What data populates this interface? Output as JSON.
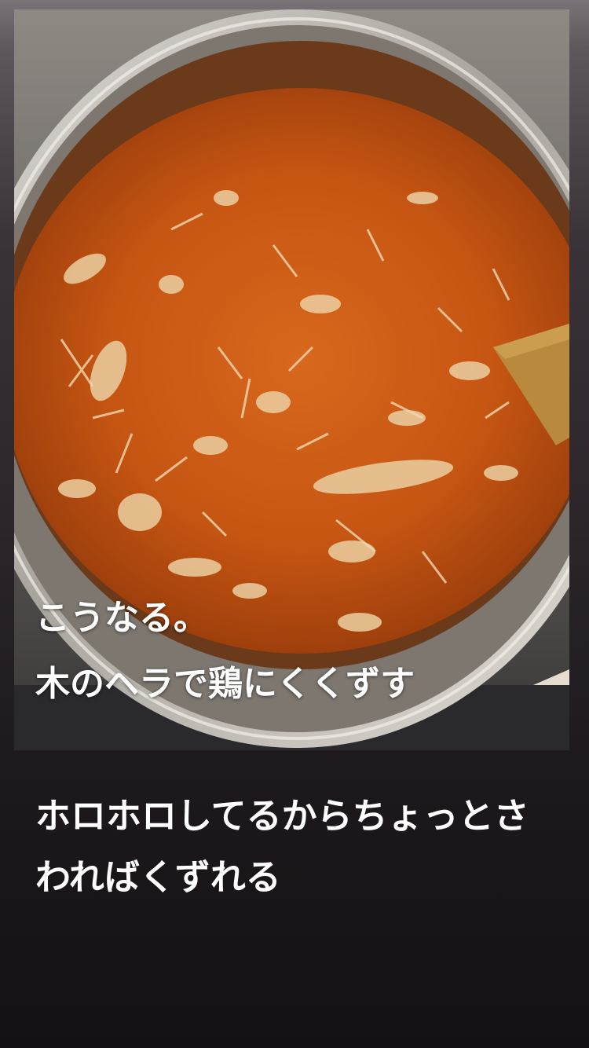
{
  "photo": {
    "alt": "",
    "colors": {
      "pot_rim": "#c9c5c0",
      "pot_inner": "#8a847d",
      "sauce": "#c85a14",
      "sauce_dark": "#9a3e0a",
      "chicken": "#e8c79a",
      "spatula": "#b98a3e",
      "stove": "#2b2a2c",
      "counter": "#e9e1d6"
    },
    "caption_line1": "こうなる。",
    "caption_line2": "木のヘラで鶏にくくずす"
  },
  "story": {
    "text": "ホロホロしてるからちょっとさわればくずれる"
  }
}
